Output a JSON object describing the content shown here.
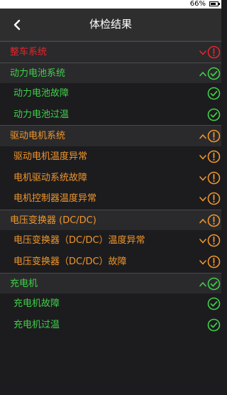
{
  "status_bar": {
    "battery_text": "66%"
  },
  "header": {
    "title": "体检结果"
  },
  "colors": {
    "error": "#e8242b",
    "ok": "#3fd04a",
    "warning": "#f0962c"
  },
  "rows": [
    {
      "type": "section",
      "label": "整车系统",
      "status": "error",
      "chevron": "down"
    },
    {
      "type": "section",
      "label": "动力电池系统",
      "status": "ok",
      "chevron": "up"
    },
    {
      "type": "item",
      "label": "动力电池故障",
      "status": "ok"
    },
    {
      "type": "item",
      "label": "动力电池过温",
      "status": "ok"
    },
    {
      "type": "section",
      "label": "驱动电机系统",
      "status": "warning",
      "chevron": "up"
    },
    {
      "type": "item",
      "label": "驱动电机温度异常",
      "status": "warning",
      "chevron": "down"
    },
    {
      "type": "item",
      "label": "电机驱动系统故障",
      "status": "warning",
      "chevron": "down"
    },
    {
      "type": "item",
      "label": "电机控制器温度异常",
      "status": "warning",
      "chevron": "down"
    },
    {
      "type": "section",
      "label": "电压变换器 (DC/DC)",
      "status": "warning",
      "chevron": "up"
    },
    {
      "type": "item",
      "label": "电压变换器（DC/DC）温度异常",
      "status": "warning",
      "chevron": "down"
    },
    {
      "type": "item",
      "label": "电压变换器（DC/DC）故障",
      "status": "warning",
      "chevron": "down"
    },
    {
      "type": "section",
      "label": "充电机",
      "status": "ok",
      "chevron": "up"
    },
    {
      "type": "item",
      "label": "充电机故障",
      "status": "ok"
    },
    {
      "type": "item",
      "label": "充电机过温",
      "status": "ok"
    }
  ]
}
